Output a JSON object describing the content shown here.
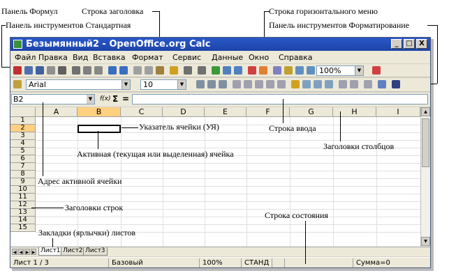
{
  "annotations": {
    "formula_panel": "Панель Формул",
    "title_bar": "Строка заголовка",
    "menu_bar": "Строка горизонтального меню",
    "std_toolbar": "Панель инструментов Стандартная",
    "fmt_toolbar": "Панель инструментов Форматирование",
    "cell_pointer": "Указатель ячейки (УЯ)",
    "input_line": "Строка ввода",
    "col_headers": "Заголовки столбцов",
    "active_cell": "Активная (текущая или выделенная) ячейка",
    "cell_address": "Адрес активной ячейки",
    "row_headers": "Заголовки строк",
    "status_bar": "Строка состояния",
    "sheet_tabs": "Закладки (ярлычки) листов"
  },
  "window": {
    "title": "Безымянный2 - OpenOffice.org Calc",
    "btn_min": "_",
    "btn_max": "□",
    "btn_close": "X"
  },
  "menu": [
    "Файл",
    "Правка",
    "Вид",
    "Вставка",
    "Формат",
    "Сервис",
    "Данные",
    "Окно",
    "Справка"
  ],
  "toolbar_std": {
    "zoom": "100%"
  },
  "toolbar_fmt": {
    "font_name": "Arial",
    "font_size": "10"
  },
  "formula": {
    "cell_ref": "B2",
    "func_icon": "f(x)",
    "sum_icon": "Σ",
    "equals_icon": "="
  },
  "grid": {
    "columns": [
      "A",
      "B",
      "C",
      "D",
      "E",
      "F",
      "G",
      "H",
      "I"
    ],
    "rows": [
      "1",
      "2",
      "3",
      "4",
      "5",
      "6",
      "7",
      "8",
      "9",
      "10",
      "11",
      "12",
      "13",
      "14",
      "15"
    ],
    "active_column": "B",
    "active_row": "2"
  },
  "sheets": [
    "Лист1",
    "Лист2",
    "Лист3"
  ],
  "status": {
    "sheet": "Лист 1 / 3",
    "style": "Базовый",
    "zoom": "100%",
    "mode": "СТАНД",
    "sum": "Сумма=0"
  },
  "colors": {
    "title_bar": "#1d45a8",
    "active_header": "#ffd080"
  }
}
